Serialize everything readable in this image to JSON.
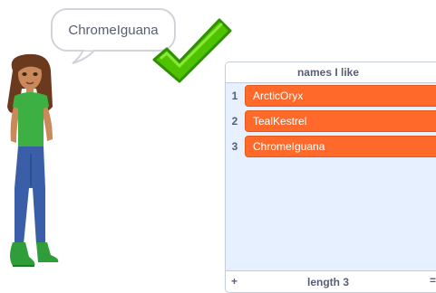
{
  "speech_bubble": {
    "text": "ChromeIguana"
  },
  "list_monitor": {
    "title": "names I like",
    "items": [
      {
        "index": "1",
        "value": "ArcticOryx"
      },
      {
        "index": "2",
        "value": "TealKestrel"
      },
      {
        "index": "3",
        "value": "ChromeIguana"
      }
    ],
    "length_label": "length 3",
    "add_symbol": "+",
    "resize_symbol": "="
  },
  "icons": {
    "check": "check-mark-icon",
    "sprite": "girl-character-sprite"
  },
  "colors": {
    "item_fill": "#ff6a2a",
    "monitor_bg": "#e6f0ff",
    "check_green": "#4fc300"
  }
}
